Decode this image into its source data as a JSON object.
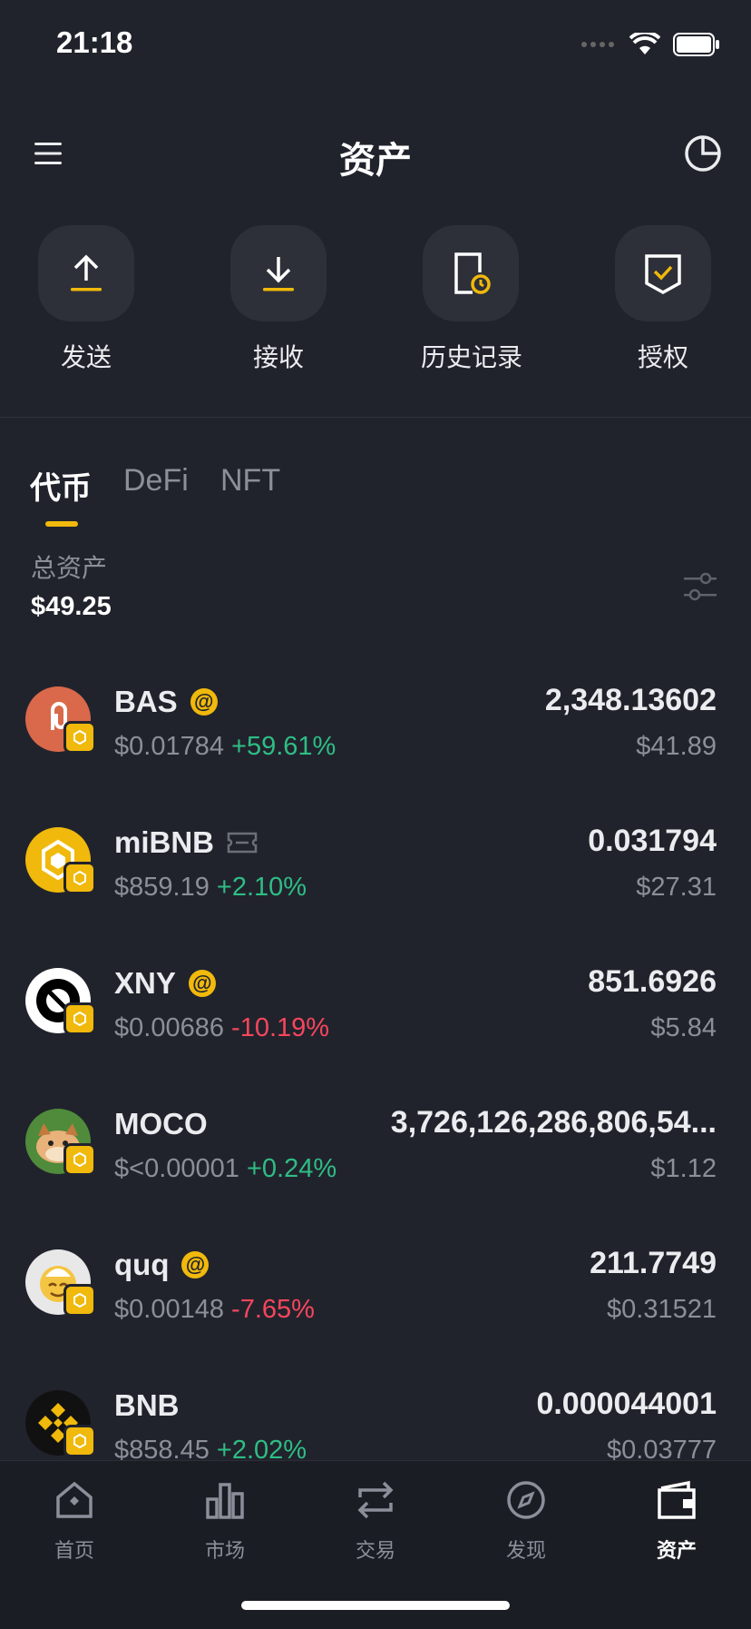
{
  "status_bar": {
    "time": "21:18"
  },
  "header": {
    "title": "资产"
  },
  "actions": [
    {
      "label": "发送",
      "icon": "send-arrow-up-icon"
    },
    {
      "label": "接收",
      "icon": "receive-arrow-down-icon"
    },
    {
      "label": "历史记录",
      "icon": "history-icon"
    },
    {
      "label": "授权",
      "icon": "approval-shield-icon"
    }
  ],
  "tabs": {
    "tokens": "代币",
    "defi": "DeFi",
    "nft": "NFT"
  },
  "total": {
    "label": "总资产",
    "value": "$49.25"
  },
  "tokens": [
    {
      "name": "BAS",
      "price": "$0.01784",
      "change": "+59.61%",
      "amount": "2,348.13602",
      "value": "$41.89"
    },
    {
      "name": "miBNB",
      "price": "$859.19",
      "change": "+2.10%",
      "amount": "0.031794",
      "value": "$27.31"
    },
    {
      "name": "XNY",
      "price": "$0.00686",
      "change": "-10.19%",
      "amount": "851.6926",
      "value": "$5.84"
    },
    {
      "name": "MOCO",
      "price": "$<0.00001",
      "change": "+0.24%",
      "amount": "3,726,126,286,806,54...",
      "value": "$1.12"
    },
    {
      "name": "quq",
      "price": "$0.00148",
      "change": "-7.65%",
      "amount": "211.7749",
      "value": "$0.31521"
    },
    {
      "name": "BNB",
      "price": "$858.45",
      "change": "+2.02%",
      "amount": "0.000044001",
      "value": "$0.03777"
    }
  ],
  "nav": {
    "home": "首页",
    "market": "市场",
    "trade": "交易",
    "discover": "发现",
    "assets": "资产"
  },
  "colors": {
    "background": "#21232c",
    "accent": "#f0b90b",
    "up": "#2ebd85",
    "down": "#f6465d"
  }
}
